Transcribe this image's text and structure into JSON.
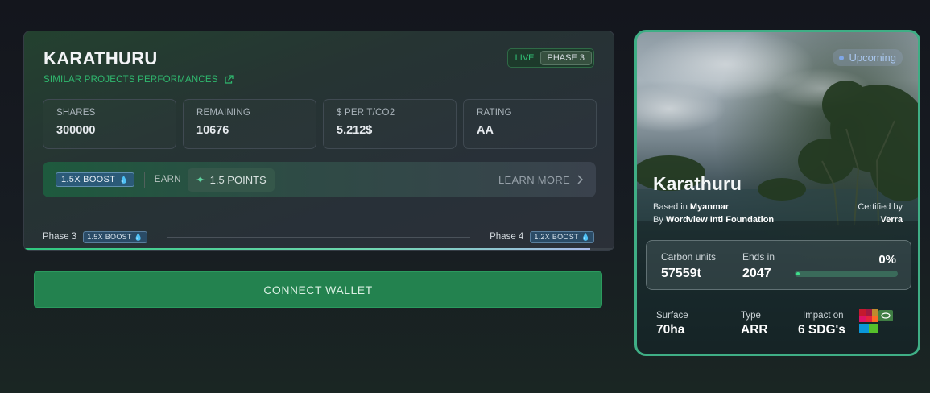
{
  "project": {
    "name": "KARATHURU",
    "similar_link": "SIMILAR PROJECTS PERFORMANCES",
    "status_live": "LIVE",
    "status_phase": "PHASE 3"
  },
  "stats": [
    {
      "label": "SHARES",
      "value": "300000"
    },
    {
      "label": "REMAINING",
      "value": "10676"
    },
    {
      "label": "$ PER T/CO2",
      "value": "5.212$"
    },
    {
      "label": "RATING",
      "value": "AA"
    }
  ],
  "boost": {
    "chip": "1.5X BOOST",
    "earn_label": "EARN",
    "points": "1.5 POINTS",
    "learn_more": "LEARN MORE"
  },
  "phases": {
    "current_label": "Phase 3",
    "current_boost": "1.5X BOOST",
    "next_label": "Phase 4",
    "next_boost": "1.2X BOOST",
    "progress": 0.96
  },
  "connect_wallet": "CONNECT WALLET",
  "card": {
    "status": "Upcoming",
    "title": "Karathuru",
    "based_prefix": "Based in",
    "country": "Myanmar",
    "by_prefix": "By",
    "developer": "Wordview Intl Foundation",
    "certified_label": "Certified by",
    "certifier": "Verra",
    "carbon_label": "Carbon units",
    "carbon_value": "57559t",
    "ends_label": "Ends in",
    "ends_value": "2047",
    "progress_pct": "0%",
    "surface_label": "Surface",
    "surface_value": "70ha",
    "type_label": "Type",
    "type_value": "ARR",
    "impact_label": "Impact on",
    "impact_value": "6 SDG's"
  },
  "colors": {
    "accent_green": "#2fb86e",
    "button_green": "#23824f",
    "card_border": "#3fae85",
    "boost_blue": "#2b5a78"
  }
}
